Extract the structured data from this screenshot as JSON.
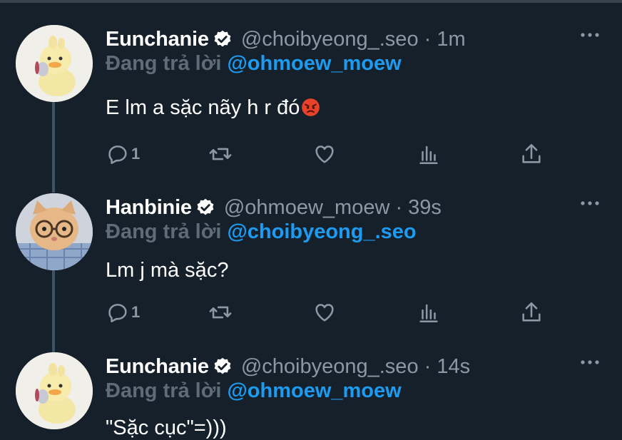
{
  "tweets": [
    {
      "name": "Eunchanie",
      "handle": "@choibyeong_.seo · 1m",
      "reply_prefix": "Đang trả lời ",
      "reply_to": "@ohmoew_moew",
      "text": "E lm a sặc nãy h r đó",
      "text_emoji": "angry-face-icon",
      "reply_count": "1",
      "avatar": "duck-avatar"
    },
    {
      "name": "Hanbinie",
      "handle": "@ohmoew_moew · 39s",
      "reply_prefix": "Đang trả lời ",
      "reply_to": "@choibyeong_.seo",
      "text": "Lm j mà sặc?",
      "reply_count": "1",
      "avatar": "cat-with-glasses-avatar"
    },
    {
      "name": "Eunchanie",
      "handle": "@choibyeong_.seo · 14s",
      "reply_prefix": "Đang trả lời ",
      "reply_to": "@ohmoew_moew",
      "text": "\"Sặc cục\"=)))",
      "avatar": "duck-avatar"
    }
  ],
  "colors": {
    "background": "#15202b",
    "mention": "#1d9bf0",
    "secondary": "#8b98a5",
    "thread_line": "#3d5466"
  }
}
